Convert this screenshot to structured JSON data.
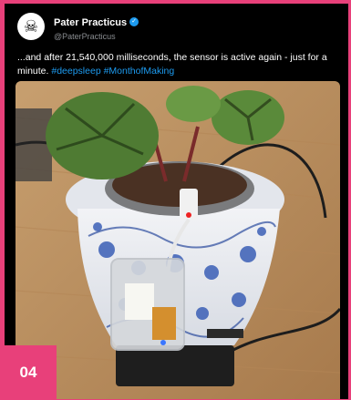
{
  "tweet": {
    "author_name": "Pater Practicus",
    "author_handle": "@PaterPracticus",
    "text_main": "...and after 21,540,000 milliseconds, the sensor is active again - just for a minute.",
    "hashtags": [
      "#deepsleep",
      "#MonthofMaking"
    ]
  },
  "figure_number": "04",
  "icons": {
    "avatar": "skull-crossbones-icon",
    "verified": "verified-checkmark-icon"
  },
  "colors": {
    "frame": "#e8407a",
    "tweet_background": "#000000",
    "hashtag": "#1d9bf0",
    "verified": "#1d9bf0",
    "handle": "#8a8d91"
  }
}
